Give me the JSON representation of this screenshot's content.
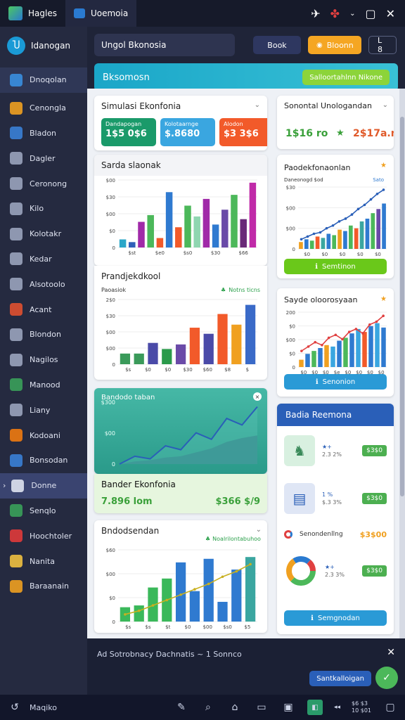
{
  "window": {
    "tabs": [
      {
        "label": "Hagles"
      },
      {
        "label": "Uoemoia"
      }
    ]
  },
  "sidebar": {
    "header": "Idanogan",
    "items": [
      {
        "label": "Dnoqolan",
        "icon": "globe-icon",
        "color": "#3a8fe0"
      },
      {
        "label": "Cenongla",
        "icon": "folder-icon",
        "color": "#f0a020"
      },
      {
        "label": "Bladon",
        "icon": "app-icon",
        "color": "#3a7fd6"
      },
      {
        "label": "Dagler",
        "icon": "grid-icon",
        "color": "#9aa3bd"
      },
      {
        "label": "Ceronong",
        "icon": "folder-open-icon",
        "color": "#9aa3bd"
      },
      {
        "label": "Kilo",
        "icon": "link-icon",
        "color": "#9aa3bd"
      },
      {
        "label": "Kolotakr",
        "icon": "tools-icon",
        "color": "#9aa3bd"
      },
      {
        "label": "Kedar",
        "icon": "table-icon",
        "color": "#9aa3bd"
      },
      {
        "label": "Alsotoolo",
        "icon": "sparkle-icon",
        "color": "#9aa3bd"
      },
      {
        "label": "Acant",
        "icon": "layers-icon",
        "color": "#e05030"
      },
      {
        "label": "Blondon",
        "icon": "bars-icon",
        "color": "#9aa3bd"
      },
      {
        "label": "Nagilos",
        "icon": "tag-icon",
        "color": "#9aa3bd"
      },
      {
        "label": "Manood",
        "icon": "cloud-icon",
        "color": "#3aa05a"
      },
      {
        "label": "Liany",
        "icon": "box-icon",
        "color": "#9aa3bd"
      },
      {
        "label": "Kodoani",
        "icon": "circle-icon",
        "color": "#f07a10"
      },
      {
        "label": "Bonsodan",
        "icon": "pencil-icon",
        "color": "#3a7fd6"
      },
      {
        "label": "Donne",
        "icon": "gear-icon",
        "color": "#dfe3f0"
      },
      {
        "label": "Senqlo",
        "icon": "sheet-icon",
        "color": "#3aa05a"
      },
      {
        "label": "Hoochtoler",
        "icon": "calendar-icon",
        "color": "#e03a3a"
      },
      {
        "label": "Nanita",
        "icon": "people-icon",
        "color": "#f0c040"
      },
      {
        "label": "Baraanain",
        "icon": "users-icon",
        "color": "#f0a020"
      }
    ],
    "selected_index": 16
  },
  "topbar": {
    "search_value": "Ungol Bkonosia",
    "btn_book": "Book",
    "btn_bloonn": "Bloonn",
    "btn_extra": "L 8"
  },
  "banner": {
    "title": "Bksomosn",
    "button": "Salloortahlnn Nikone"
  },
  "simulasi": {
    "title": "Simulasi Ekonfonia",
    "kpis": [
      {
        "label": "Dandapogan",
        "value": "1$5 0$6",
        "color": "#1a9a6a"
      },
      {
        "label": "Kolotaarnge",
        "value": "$.8680",
        "color": "#3aa6e0"
      },
      {
        "label": "Alodon",
        "value": "$3 3$6",
        "color": "#f25a2a"
      }
    ]
  },
  "sondl": {
    "title": "Sonontal Unologandan",
    "v1": "1$16 ro",
    "v2": "2$17a.n"
  },
  "chart_sardi": {
    "title": "Sarda slaonak",
    "chart_data": {
      "type": "bar",
      "yticks": [
        "0",
        "$0",
        "$00",
        "$30",
        "$00"
      ],
      "xticks": [
        "$st",
        "$e0",
        "$s0",
        "$30",
        "$66"
      ],
      "values": [
        12,
        8,
        38,
        48,
        14,
        82,
        30,
        62,
        46,
        72,
        34,
        56,
        78,
        42,
        96
      ],
      "colors": [
        "#2aa6c8",
        "#2f5fb8",
        "#a02aa8",
        "#4cb85a",
        "#f25a2a",
        "#2f7ad0",
        "#f25a2a",
        "#4cb85a",
        "#8fd6b0",
        "#a02aa8",
        "#2f7ad0",
        "#6a4aa8",
        "#4cb85a",
        "#6a2a78",
        "#c02aa8"
      ]
    }
  },
  "chart_prandj": {
    "title": "Prandjekdkool",
    "subtitle": "Paoasiok",
    "legend": "Notns ticns",
    "chart_data": {
      "type": "bar",
      "yticks": [
        "0",
        "$00",
        "$00",
        "$30",
        "2$0"
      ],
      "xticks": [
        "$s",
        "$0",
        "$0",
        "$30",
        "$60",
        "$8",
        "$"
      ],
      "values": [
        14,
        14,
        28,
        20,
        26,
        48,
        40,
        66,
        52,
        78
      ],
      "colors": [
        "#3a9a5a",
        "#3a9a5a",
        "#4a4aa8",
        "#2a9a4a",
        "#6a4aa8",
        "#f25a2a",
        "#4a4aa8",
        "#f25a2a",
        "#f0a020",
        "#3a6ac8"
      ]
    }
  },
  "chart_area": {
    "title": "Bandodo taban",
    "yticks": [
      "$300",
      "$00",
      "0"
    ],
    "chart_data": {
      "type": "area",
      "line": [
        0,
        12,
        8,
        28,
        22,
        48,
        38,
        70,
        60,
        88
      ],
      "fill": [
        0,
        4,
        6,
        10,
        12,
        18,
        24,
        34,
        40,
        44
      ]
    }
  },
  "bandler": {
    "title": "Bander Ekonfonia",
    "left_value": "7.896 lom",
    "right_value": "$366 $/9"
  },
  "chart_bottom": {
    "title": "Bndodsendan",
    "legend": "Noalrilontabuhoo",
    "chart_data": {
      "type": "bar",
      "yticks": [
        "0",
        "$0",
        "$00",
        "$60"
      ],
      "xticks": [
        "$s",
        "$s",
        "$t",
        "$0",
        "$00",
        "$s0",
        "$5"
      ],
      "values": [
        16,
        18,
        38,
        48,
        66,
        34,
        70,
        22,
        58,
        72
      ],
      "colors": [
        "#3ab85a",
        "#3ab85a",
        "#3ab85a",
        "#3ab85a",
        "#2f7ad0",
        "#2f7ad0",
        "#2f7ad0",
        "#2f7ad0",
        "#2f7ad0",
        "#3aa6a0"
      ],
      "line": [
        8,
        12,
        18,
        24,
        30,
        36,
        42,
        50,
        56,
        64
      ]
    }
  },
  "chart_right1": {
    "title": "Paodekfonaonlan",
    "legend1": "Daneonogd $od",
    "legend2": "Sato",
    "button": "Semtinon",
    "chart_data": {
      "type": "bar",
      "yticks": [
        "0",
        "$00",
        "$00",
        "$30"
      ],
      "xticks": [
        "$0",
        "$0",
        "$0",
        "$0",
        "$0"
      ],
      "values": [
        10,
        14,
        12,
        18,
        16,
        22,
        20,
        28,
        26,
        34,
        30,
        40,
        44,
        52,
        58,
        66
      ],
      "colors": [
        "#f0a020",
        "#2f7ad0",
        "#4cb85a",
        "#f25a2a",
        "#3aa6a0",
        "#2f7ad0",
        "#4cb85a",
        "#f0a020",
        "#2f7ad0",
        "#4cb85a",
        "#f25a2a",
        "#3aa6a0",
        "#2f7ad0",
        "#4cb85a",
        "#6a4aa8",
        "#2f7ad0"
      ],
      "line": [
        14,
        18,
        22,
        24,
        30,
        34,
        40,
        44,
        50,
        58,
        64,
        72,
        80,
        86
      ]
    }
  },
  "chart_right2": {
    "title": "Sayde oloorosyaan",
    "button": "Senonion",
    "chart_data": {
      "type": "bar",
      "yticks": [
        "0",
        "$0",
        "$00",
        "$0",
        "200"
      ],
      "xticks": [
        "$0",
        "$0",
        "$0",
        "$e",
        "$0",
        "$0",
        "$0",
        "$0"
      ],
      "values": [
        10,
        18,
        22,
        26,
        30,
        28,
        36,
        40,
        46,
        52,
        48,
        56,
        60,
        54
      ],
      "colors": [
        "#f0a020",
        "#2f7ad0",
        "#4cb85a",
        "#2f7ad0",
        "#f0a020",
        "#3aa6e0",
        "#2f7ad0",
        "#4cb85a",
        "#2f7ad0",
        "#3aa6e0",
        "#f25a2a",
        "#2f7ad0",
        "#3aa6e0",
        "#2f7ad0"
      ],
      "line": [
        22,
        28,
        34,
        30,
        40,
        44,
        38,
        48,
        52,
        46,
        58,
        62,
        70
      ]
    }
  },
  "badia": {
    "title": "Badia Reemona",
    "items": [
      {
        "meta": "2.3 2%",
        "price": "$3$0"
      },
      {
        "meta": "$.3 3%",
        "price": "$3$0"
      },
      {
        "meta": "Senondenllng",
        "price": "$3$00"
      },
      {
        "meta": "2.3 3%",
        "price": "$3$0"
      }
    ],
    "button": "Semgnodan"
  },
  "statusbar": {
    "text": "Ad Sotrobnacy Dachnatis ~ 1 Sonnco",
    "button": "Santkalloigan"
  },
  "taskbar": {
    "start_label": "Maqiko",
    "clock_time": "$6 $3",
    "clock_date": "10 $01"
  }
}
